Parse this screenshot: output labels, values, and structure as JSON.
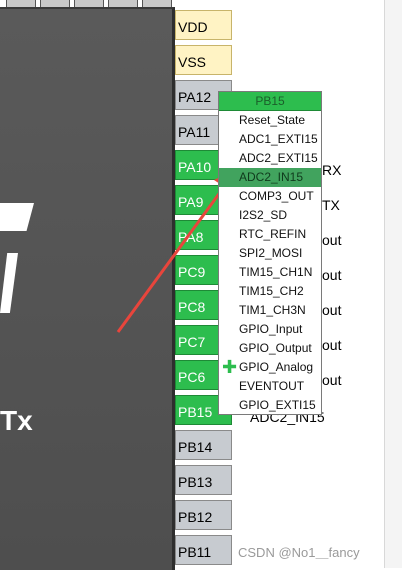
{
  "pins": [
    {
      "label": "VDD",
      "color": "yellow"
    },
    {
      "label": "VSS",
      "color": "yellow"
    },
    {
      "label": "PA12",
      "color": "gray"
    },
    {
      "label": "PA11",
      "color": "gray"
    },
    {
      "label": "PA10",
      "color": "green"
    },
    {
      "label": "PA9",
      "color": "green"
    },
    {
      "label": "PA8",
      "color": "green"
    },
    {
      "label": "PC9",
      "color": "green"
    },
    {
      "label": "PC8",
      "color": "green"
    },
    {
      "label": "PC7",
      "color": "green"
    },
    {
      "label": "PC6",
      "color": "green"
    },
    {
      "label": "PB15",
      "color": "green"
    },
    {
      "label": "PB14",
      "color": "gray"
    },
    {
      "label": "PB13",
      "color": "gray"
    },
    {
      "label": "PB12",
      "color": "gray"
    },
    {
      "label": "PB11",
      "color": "gray"
    }
  ],
  "chip_text": "Tx",
  "signals": {
    "pa10": "RX",
    "pa9": "TX",
    "pa8": "out",
    "pc9": "out",
    "pc8": "out",
    "pc7": "out",
    "pc6": "out",
    "pb15": "ADC2_IN15"
  },
  "menu": {
    "header": "PB15",
    "items": [
      "Reset_State",
      "ADC1_EXTI15",
      "ADC2_EXTI15",
      "ADC2_IN15",
      "COMP3_OUT",
      "I2S2_SD",
      "RTC_REFIN",
      "SPI2_MOSI",
      "TIM15_CH1N",
      "TIM15_CH2",
      "TIM1_CH3N",
      "GPIO_Input",
      "GPIO_Output",
      "GPIO_Analog",
      "EVENTOUT",
      "GPIO_EXTI15"
    ],
    "highlighted": "ADC2_IN15",
    "checked": "GPIO_Analog",
    "check_glyph": "✚"
  },
  "watermark": "CSDN @No1＿fancy",
  "colors": {
    "pin_green": "#2dbd4e",
    "highlight": "#41a35e",
    "arrow": "#e8453c"
  }
}
